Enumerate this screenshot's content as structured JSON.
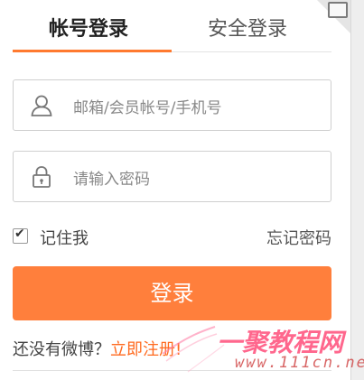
{
  "tabs": {
    "account_login": "帐号登录",
    "secure_login": "安全登录"
  },
  "form": {
    "account_placeholder": "邮箱/会员帐号/手机号",
    "password_placeholder": "请输入密码",
    "remember_label": "记住我",
    "remember_checked": true,
    "forgot_label": "忘记密码",
    "submit_label": "登录"
  },
  "footer": {
    "no_account": "还没有微博？",
    "register_link": "立即注册!"
  },
  "watermark": {
    "site_name": "一聚教程网",
    "site_domain": "www.111cn.net"
  },
  "colors": {
    "accent": "#ff7f3c",
    "tab_underline": "#ff7a2f",
    "link": "#ff6a1f"
  }
}
